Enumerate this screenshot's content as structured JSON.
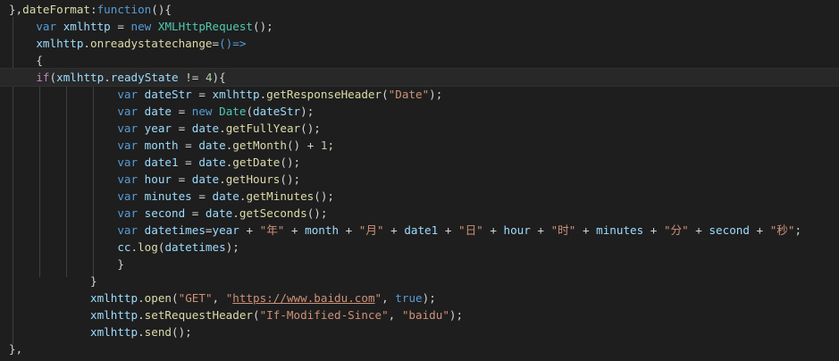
{
  "editor": {
    "colors": {
      "background": "#1e1e1e",
      "keyword": "#569cd6",
      "control": "#c586c0",
      "variable": "#9cdcfe",
      "function": "#dcdcaa",
      "class": "#4ec9b0",
      "string": "#ce9178",
      "number": "#b5cea8",
      "punctuation": "#d4d4d4"
    },
    "lines": [
      [
        [
          "t-pun",
          "},"
        ],
        [
          "t-fn",
          "dateFormat"
        ],
        [
          "t-pun",
          ":"
        ],
        [
          "t-kw",
          "function"
        ],
        [
          "t-pun",
          "(){"
        ]
      ],
      [
        [
          "t-pun",
          "    "
        ],
        [
          "t-kw",
          "var"
        ],
        [
          "t-pun",
          " "
        ],
        [
          "t-var",
          "xmlhttp"
        ],
        [
          "t-pun",
          " = "
        ],
        [
          "t-kw",
          "new"
        ],
        [
          "t-pun",
          " "
        ],
        [
          "t-cls",
          "XMLHttpRequest"
        ],
        [
          "t-pun",
          "();"
        ]
      ],
      [
        [
          "t-pun",
          "    "
        ],
        [
          "t-var",
          "xmlhttp"
        ],
        [
          "t-pun",
          "."
        ],
        [
          "t-fn",
          "onreadystatechange"
        ],
        [
          "t-pun",
          "="
        ],
        [
          "t-kw",
          "()=>"
        ]
      ],
      [
        [
          "t-pun",
          "    {"
        ]
      ],
      [
        [
          "t-pun",
          "    "
        ],
        [
          "t-ctl",
          "if"
        ],
        [
          "t-pun",
          "("
        ],
        [
          "t-var",
          "xmlhttp"
        ],
        [
          "t-pun",
          "."
        ],
        [
          "t-var",
          "readyState"
        ],
        [
          "t-pun",
          " != "
        ],
        [
          "t-num",
          "4"
        ],
        [
          "t-pun",
          "){"
        ]
      ],
      [
        [
          "t-pun",
          "                "
        ],
        [
          "t-kw",
          "var"
        ],
        [
          "t-pun",
          " "
        ],
        [
          "t-var",
          "dateStr"
        ],
        [
          "t-pun",
          " = "
        ],
        [
          "t-var",
          "xmlhttp"
        ],
        [
          "t-pun",
          "."
        ],
        [
          "t-fn",
          "getResponseHeader"
        ],
        [
          "t-pun",
          "("
        ],
        [
          "t-str",
          "\"Date\""
        ],
        [
          "t-pun",
          ");"
        ]
      ],
      [
        [
          "t-pun",
          "                "
        ],
        [
          "t-kw",
          "var"
        ],
        [
          "t-pun",
          " "
        ],
        [
          "t-var",
          "date"
        ],
        [
          "t-pun",
          " = "
        ],
        [
          "t-kw",
          "new"
        ],
        [
          "t-pun",
          " "
        ],
        [
          "t-cls",
          "Date"
        ],
        [
          "t-pun",
          "("
        ],
        [
          "t-var",
          "dateStr"
        ],
        [
          "t-pun",
          ");"
        ]
      ],
      [
        [
          "t-pun",
          "                "
        ],
        [
          "t-kw",
          "var"
        ],
        [
          "t-pun",
          " "
        ],
        [
          "t-var",
          "year"
        ],
        [
          "t-pun",
          " = "
        ],
        [
          "t-var",
          "date"
        ],
        [
          "t-pun",
          "."
        ],
        [
          "t-fn",
          "getFullYear"
        ],
        [
          "t-pun",
          "();"
        ]
      ],
      [
        [
          "t-pun",
          "                "
        ],
        [
          "t-kw",
          "var"
        ],
        [
          "t-pun",
          " "
        ],
        [
          "t-var",
          "month"
        ],
        [
          "t-pun",
          " = "
        ],
        [
          "t-var",
          "date"
        ],
        [
          "t-pun",
          "."
        ],
        [
          "t-fn",
          "getMonth"
        ],
        [
          "t-pun",
          "() + "
        ],
        [
          "t-num",
          "1"
        ],
        [
          "t-pun",
          ";"
        ]
      ],
      [
        [
          "t-pun",
          "                "
        ],
        [
          "t-kw",
          "var"
        ],
        [
          "t-pun",
          " "
        ],
        [
          "t-var",
          "date1"
        ],
        [
          "t-pun",
          " = "
        ],
        [
          "t-var",
          "date"
        ],
        [
          "t-pun",
          "."
        ],
        [
          "t-fn",
          "getDate"
        ],
        [
          "t-pun",
          "();"
        ]
      ],
      [
        [
          "t-pun",
          "                "
        ],
        [
          "t-kw",
          "var"
        ],
        [
          "t-pun",
          " "
        ],
        [
          "t-var",
          "hour"
        ],
        [
          "t-pun",
          " = "
        ],
        [
          "t-var",
          "date"
        ],
        [
          "t-pun",
          "."
        ],
        [
          "t-fn",
          "getHours"
        ],
        [
          "t-pun",
          "();"
        ]
      ],
      [
        [
          "t-pun",
          "                "
        ],
        [
          "t-kw",
          "var"
        ],
        [
          "t-pun",
          " "
        ],
        [
          "t-var",
          "minutes"
        ],
        [
          "t-pun",
          " = "
        ],
        [
          "t-var",
          "date"
        ],
        [
          "t-pun",
          "."
        ],
        [
          "t-fn",
          "getMinutes"
        ],
        [
          "t-pun",
          "();"
        ]
      ],
      [
        [
          "t-pun",
          "                "
        ],
        [
          "t-kw",
          "var"
        ],
        [
          "t-pun",
          " "
        ],
        [
          "t-var",
          "second"
        ],
        [
          "t-pun",
          " = "
        ],
        [
          "t-var",
          "date"
        ],
        [
          "t-pun",
          "."
        ],
        [
          "t-fn",
          "getSeconds"
        ],
        [
          "t-pun",
          "();"
        ]
      ],
      [
        [
          "t-pun",
          "                "
        ],
        [
          "t-kw",
          "var"
        ],
        [
          "t-pun",
          " "
        ],
        [
          "t-var",
          "datetimes"
        ],
        [
          "t-pun",
          "="
        ],
        [
          "t-var",
          "year"
        ],
        [
          "t-pun",
          " + "
        ],
        [
          "t-str",
          "\"年\""
        ],
        [
          "t-pun",
          " + "
        ],
        [
          "t-var",
          "month"
        ],
        [
          "t-pun",
          " + "
        ],
        [
          "t-str",
          "\"月\""
        ],
        [
          "t-pun",
          " + "
        ],
        [
          "t-var",
          "date1"
        ],
        [
          "t-pun",
          " + "
        ],
        [
          "t-str",
          "\"日\""
        ],
        [
          "t-pun",
          " + "
        ],
        [
          "t-var",
          "hour"
        ],
        [
          "t-pun",
          " + "
        ],
        [
          "t-str",
          "\"时\""
        ],
        [
          "t-pun",
          " + "
        ],
        [
          "t-var",
          "minutes"
        ],
        [
          "t-pun",
          " + "
        ],
        [
          "t-str",
          "\"分\""
        ],
        [
          "t-pun",
          " + "
        ],
        [
          "t-var",
          "second"
        ],
        [
          "t-pun",
          " + "
        ],
        [
          "t-str",
          "\"秒\""
        ],
        [
          "t-pun",
          ";"
        ]
      ],
      [
        [
          "t-pun",
          "                "
        ],
        [
          "t-var",
          "cc"
        ],
        [
          "t-pun",
          "."
        ],
        [
          "t-fn",
          "log"
        ],
        [
          "t-pun",
          "("
        ],
        [
          "t-var",
          "datetimes"
        ],
        [
          "t-pun",
          ");"
        ]
      ],
      [
        [
          "t-pun",
          "                "
        ],
        [
          "t-pun",
          "}"
        ]
      ],
      [
        [
          "t-pun",
          "            }"
        ]
      ],
      [
        [
          "t-pun",
          "            "
        ],
        [
          "t-var",
          "xmlhttp"
        ],
        [
          "t-pun",
          "."
        ],
        [
          "t-fn",
          "open"
        ],
        [
          "t-pun",
          "("
        ],
        [
          "t-str",
          "\"GET\""
        ],
        [
          "t-pun",
          ", "
        ],
        [
          "t-str",
          "\""
        ],
        [
          "t-url",
          "https://www.baidu.com"
        ],
        [
          "t-str",
          "\""
        ],
        [
          "t-pun",
          ", "
        ],
        [
          "t-kw",
          "true"
        ],
        [
          "t-pun",
          ");"
        ]
      ],
      [
        [
          "t-pun",
          "            "
        ],
        [
          "t-var",
          "xmlhttp"
        ],
        [
          "t-pun",
          "."
        ],
        [
          "t-fn",
          "setRequestHeader"
        ],
        [
          "t-pun",
          "("
        ],
        [
          "t-str",
          "\"If-Modified-Since\""
        ],
        [
          "t-pun",
          ", "
        ],
        [
          "t-str",
          "\"baidu\""
        ],
        [
          "t-pun",
          ");"
        ]
      ],
      [
        [
          "t-pun",
          "            "
        ],
        [
          "t-var",
          "xmlhttp"
        ],
        [
          "t-pun",
          "."
        ],
        [
          "t-fn",
          "send"
        ],
        [
          "t-pun",
          "();"
        ]
      ],
      [
        [
          "t-pun",
          "},"
        ]
      ]
    ]
  }
}
